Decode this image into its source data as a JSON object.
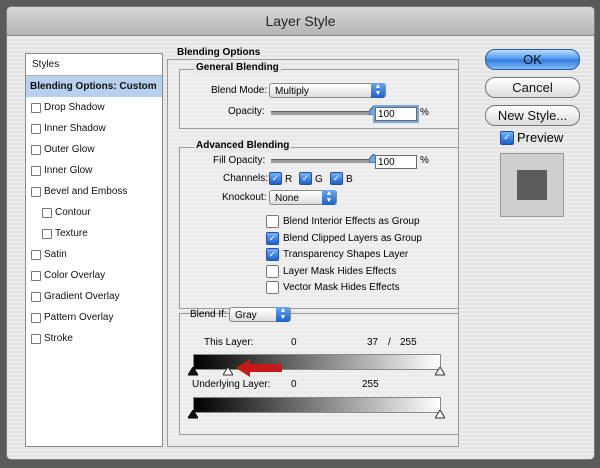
{
  "window": {
    "title": "Layer Style"
  },
  "styles_list": {
    "header": "Styles",
    "selected": "Blending Options: Custom",
    "items": [
      {
        "label": "Drop Shadow",
        "indent": false
      },
      {
        "label": "Inner Shadow",
        "indent": false
      },
      {
        "label": "Outer Glow",
        "indent": false
      },
      {
        "label": "Inner Glow",
        "indent": false
      },
      {
        "label": "Bevel and Emboss",
        "indent": false
      },
      {
        "label": "Contour",
        "indent": true
      },
      {
        "label": "Texture",
        "indent": true
      },
      {
        "label": "Satin",
        "indent": false
      },
      {
        "label": "Color Overlay",
        "indent": false
      },
      {
        "label": "Gradient Overlay",
        "indent": false
      },
      {
        "label": "Pattern Overlay",
        "indent": false
      },
      {
        "label": "Stroke",
        "indent": false
      }
    ]
  },
  "blending_options": {
    "title": "Blending Options",
    "general": {
      "title": "General Blending",
      "blend_mode_label": "Blend Mode:",
      "blend_mode_value": "Multiply",
      "opacity_label": "Opacity:",
      "opacity_value": "100",
      "opacity_unit": "%",
      "opacity_level": 1.0
    },
    "advanced": {
      "title": "Advanced Blending",
      "fill_opacity_label": "Fill Opacity:",
      "fill_opacity_value": "100",
      "fill_opacity_unit": "%",
      "fill_opacity_level": 1.0,
      "channels_label": "Channels:",
      "channels": [
        {
          "label": "R",
          "checked": true
        },
        {
          "label": "G",
          "checked": true
        },
        {
          "label": "B",
          "checked": true
        }
      ],
      "knockout_label": "Knockout:",
      "knockout_value": "None",
      "options": [
        {
          "label": "Blend Interior Effects as Group",
          "checked": false
        },
        {
          "label": "Blend Clipped Layers as Group",
          "checked": true
        },
        {
          "label": "Transparency Shapes Layer",
          "checked": true
        },
        {
          "label": "Layer Mask Hides Effects",
          "checked": false
        },
        {
          "label": "Vector Mask Hides Effects",
          "checked": false
        }
      ]
    },
    "blend_if": {
      "label": "Blend If:",
      "value": "Gray",
      "this_layer_label": "This Layer:",
      "this_layer_low": "0",
      "this_layer_mid": "37",
      "this_layer_sep": "/",
      "this_layer_high": "255",
      "underlying_label": "Underlying Layer:",
      "underlying_low": "0",
      "underlying_high": "255"
    }
  },
  "buttons": {
    "ok": "OK",
    "cancel": "Cancel",
    "new_style": "New Style...",
    "preview": "Preview",
    "preview_checked": true
  },
  "colors": {
    "accent": "#2d78dc",
    "selection": "#b7d0ee",
    "arrow": "#c41a1a"
  }
}
